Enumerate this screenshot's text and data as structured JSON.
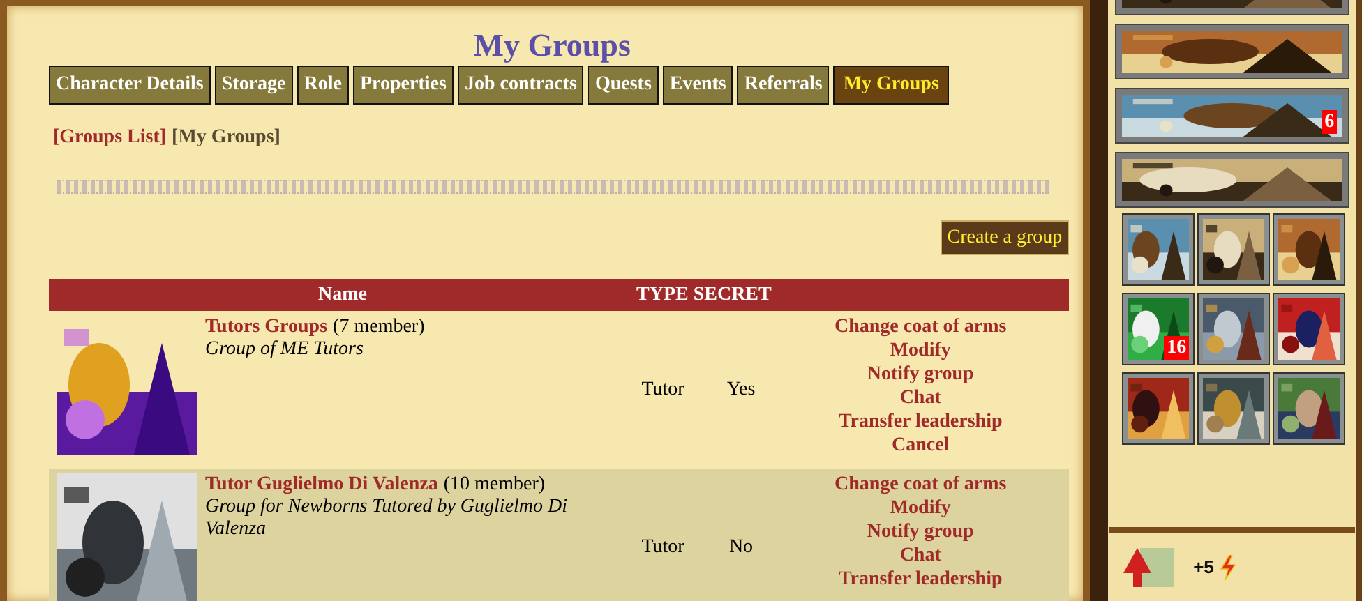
{
  "title": "My Groups",
  "tabs": [
    {
      "label": "Character Details",
      "selected": false
    },
    {
      "label": "Storage",
      "selected": false
    },
    {
      "label": "Role",
      "selected": false
    },
    {
      "label": "Properties",
      "selected": false
    },
    {
      "label": "Job contracts",
      "selected": false
    },
    {
      "label": "Quests",
      "selected": false
    },
    {
      "label": "Events",
      "selected": false
    },
    {
      "label": "Referrals",
      "selected": false
    },
    {
      "label": "My Groups",
      "selected": true
    }
  ],
  "breadcrumb": [
    {
      "label": "[Groups List]",
      "kind": "link"
    },
    {
      "label": "[My Groups]",
      "kind": "current"
    }
  ],
  "create_button": "Create a group",
  "table": {
    "columns": [
      "Name",
      "TYPE SECRET"
    ],
    "rows": [
      {
        "emblem": {
          "kind": "picture"
        },
        "name": "Tutors Groups",
        "members": "(7 member)",
        "description": "Group of ME Tutors",
        "type": "Tutor",
        "secret": "Yes",
        "actions": [
          "Change coat of arms",
          "Modify",
          "Notify group",
          "Chat",
          "Transfer leadership",
          "Cancel"
        ]
      },
      {
        "emblem": {
          "kind": "picture"
        },
        "name": "Tutor Guglielmo Di Valenza",
        "members": "(10 member)",
        "description": "Group for Newborns Tutored by Guglielmo Di Valenza",
        "type": "Tutor",
        "secret": "No",
        "actions": [
          "Change coat of arms",
          "Modify",
          "Notify group",
          "Chat",
          "Transfer leadership"
        ]
      }
    ]
  },
  "sidebar": {
    "banners": [
      {
        "kind": "picture"
      },
      {
        "kind": "picture"
      },
      {
        "kind": "picture",
        "badge": "6"
      },
      {
        "kind": "picture"
      }
    ],
    "tiles": [
      {
        "kind": "picture"
      },
      {
        "kind": "picture"
      },
      {
        "kind": "picture"
      },
      {
        "kind": "picture",
        "badge": "16"
      },
      {
        "kind": "picture"
      },
      {
        "kind": "picture"
      },
      {
        "kind": "picture"
      },
      {
        "kind": "picture"
      },
      {
        "kind": "picture"
      }
    ],
    "energy": "+5"
  }
}
